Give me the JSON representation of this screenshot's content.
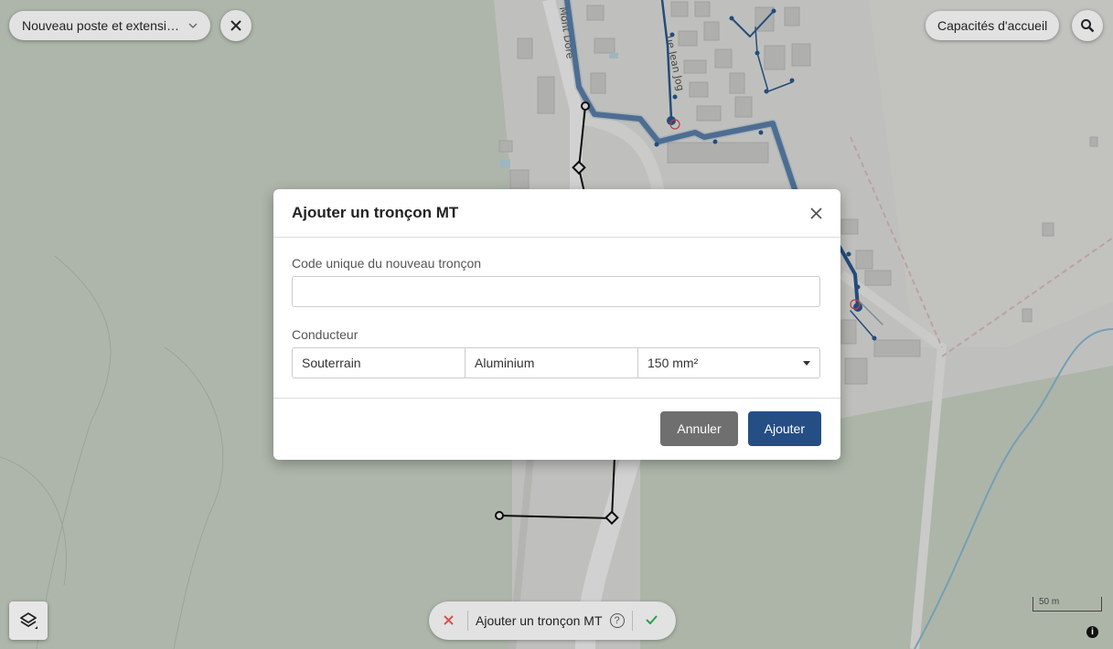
{
  "toolbar": {
    "mode_select_value": "Nouveau poste et extensi…",
    "capacites_label": "Capacités d'accueil"
  },
  "icons": {
    "chevron": "chevron-down-icon",
    "close": "close-icon",
    "search": "search-icon",
    "layers": "layers-icon",
    "help": "help-icon",
    "check": "check-icon",
    "info": "info-icon"
  },
  "map": {
    "street_labels": [
      "Mont Dore",
      "ue Jean Jog"
    ],
    "scale_label": "50 m"
  },
  "modal": {
    "title": "Ajouter un tronçon MT",
    "code_label": "Code unique du nouveau tronçon",
    "code_value": "",
    "conducteur_label": "Conducteur",
    "conducteur": {
      "type": "Souterrain",
      "material": "Aluminium",
      "section": "150 mm²"
    },
    "cancel_label": "Annuler",
    "add_label": "Ajouter"
  },
  "bottom_bar": {
    "label": "Ajouter un tronçon MT",
    "help_glyph": "?"
  },
  "colors": {
    "network_blue": "#2d5d96",
    "primary_button": "#254e85",
    "cancel_button": "#6f6f6f",
    "cancel_x": "#d9534f",
    "confirm_check": "#2e9e4f"
  }
}
